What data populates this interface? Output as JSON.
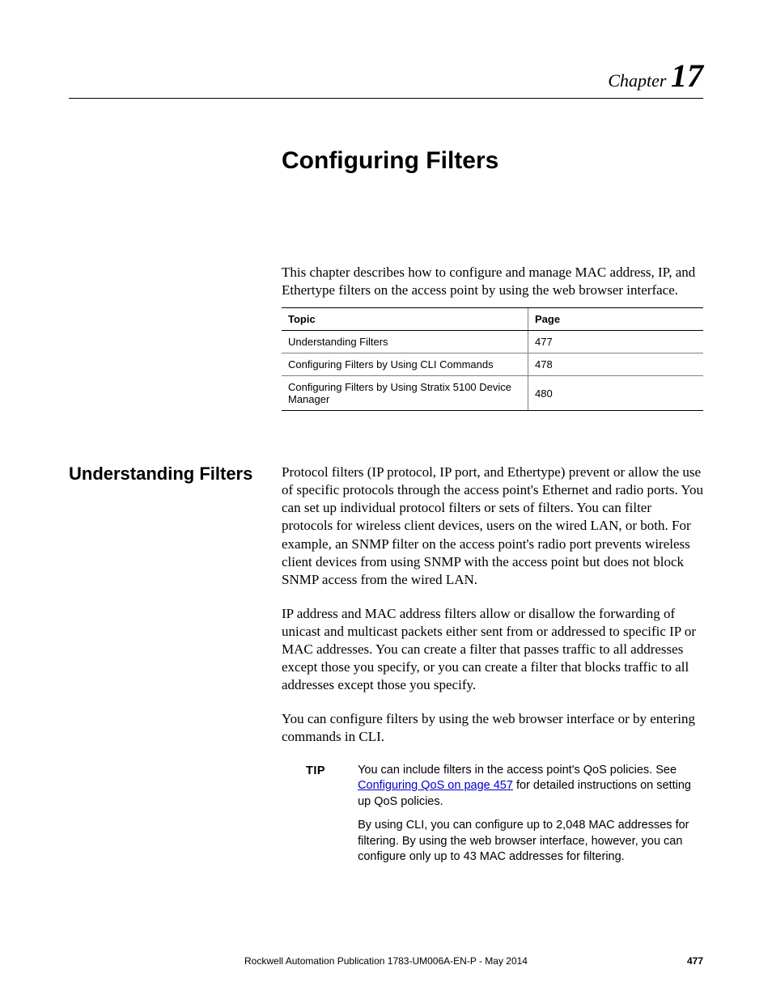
{
  "header": {
    "chapter_word": "Chapter",
    "chapter_num": "17"
  },
  "title": "Configuring Filters",
  "intro": "This chapter describes how to configure and manage MAC address, IP, and Ethertype filters on the access point by using the web browser interface.",
  "topics_table": {
    "headers": {
      "topic": "Topic",
      "page": "Page"
    },
    "rows": [
      {
        "topic": "Understanding Filters",
        "page": "477"
      },
      {
        "topic": "Configuring Filters by Using CLI Commands",
        "page": "478"
      },
      {
        "topic": "Configuring Filters by Using Stratix 5100 Device Manager",
        "page": "480"
      }
    ]
  },
  "section": {
    "heading": "Understanding Filters",
    "paragraphs": [
      "Protocol filters (IP protocol, IP port, and Ethertype) prevent or allow the use of specific protocols through the access point's Ethernet and radio ports. You can set up individual protocol filters or sets of filters. You can filter protocols for wireless client devices, users on the wired LAN, or both. For example, an SNMP filter on the access point's radio port prevents wireless client devices from using SNMP with the access point but does not block SNMP access from the wired LAN.",
      "IP address and MAC address filters allow or disallow the forwarding of unicast and multicast packets either sent from or addressed to specific IP or MAC addresses. You can create a filter that passes traffic to all addresses except those you specify, or you can create a filter that blocks traffic to all addresses except those you specify.",
      "You can configure filters by using the web browser interface or by entering commands in CLI."
    ]
  },
  "tip": {
    "label": "TIP",
    "p1_pre": "You can include filters in the access point's QoS policies. See ",
    "p1_link": "Configuring QoS on page 457",
    "p1_post": " for detailed instructions on setting up QoS policies.",
    "p2": "By using CLI, you can configure up to 2,048 MAC addresses for filtering. By using the web browser interface, however, you can configure only up to 43 MAC addresses for filtering."
  },
  "footer": {
    "text": "Rockwell Automation Publication 1783-UM006A-EN-P - May 2014",
    "page": "477"
  }
}
